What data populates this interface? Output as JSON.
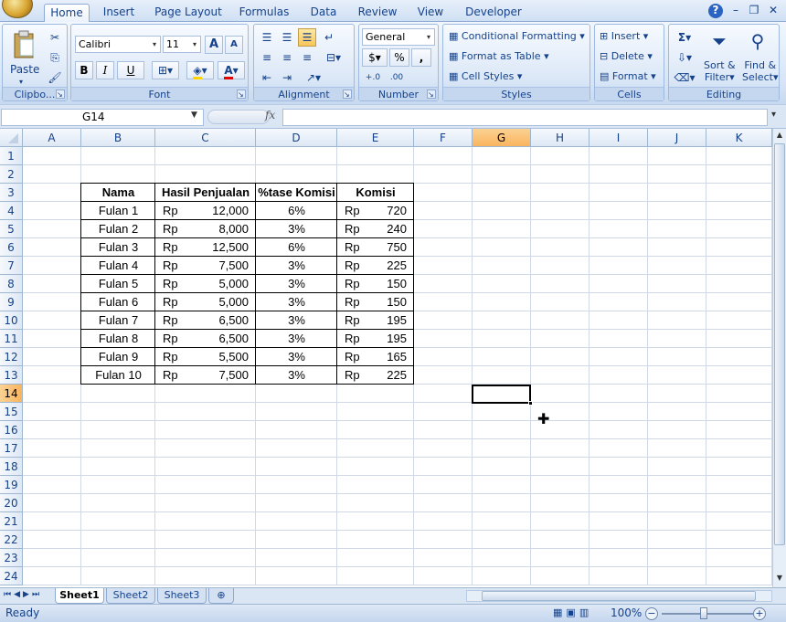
{
  "tabs": [
    "Home",
    "Insert",
    "Page Layout",
    "Formulas",
    "Data",
    "Review",
    "View",
    "Developer"
  ],
  "active_tab": "Home",
  "window": {
    "help": "?",
    "minimize": "–",
    "restore": "❐",
    "close": "✕"
  },
  "ribbon": {
    "clipboard": {
      "label": "Clipbo...",
      "paste": "Paste"
    },
    "font": {
      "label": "Font",
      "name": "Calibri",
      "size": "11",
      "grow": "A",
      "shrink": "A",
      "bold": "B",
      "italic": "I",
      "underline": "U",
      "fontcolor": "A"
    },
    "alignment": {
      "label": "Alignment"
    },
    "number": {
      "label": "Number",
      "format": "General",
      "currency": "$",
      "percent": "%",
      "comma": ","
    },
    "styles": {
      "label": "Styles",
      "conditional": "Conditional Formatting",
      "format_table": "Format as Table",
      "cell_styles": "Cell Styles"
    },
    "cells": {
      "label": "Cells",
      "insert": "Insert",
      "delete": "Delete",
      "format": "Format"
    },
    "editing": {
      "label": "Editing",
      "sort1": "Sort &",
      "sort2": "Filter",
      "find1": "Find &",
      "find2": "Select"
    }
  },
  "formula_bar": {
    "name_box": "G14",
    "fx": "fx",
    "formula": ""
  },
  "columns": [
    "A",
    "B",
    "C",
    "D",
    "E",
    "F",
    "G",
    "H",
    "I",
    "J",
    "K"
  ],
  "selected_column": "G",
  "selected_row": 14,
  "rows": [
    1,
    2,
    3,
    4,
    5,
    6,
    7,
    8,
    9,
    10,
    11,
    12,
    13,
    14,
    15,
    16,
    17,
    18,
    19,
    20,
    21,
    22,
    23,
    24
  ],
  "table": {
    "headers": [
      "Nama",
      "Hasil Penjualan",
      "%tase Komisi",
      "Komisi"
    ],
    "rows": [
      {
        "nama": "Fulan 1",
        "rp1": "Rp",
        "hasil": "12,000",
        "pct": "6%",
        "rp2": "Rp",
        "komisi": "720"
      },
      {
        "nama": "Fulan 2",
        "rp1": "Rp",
        "hasil": "8,000",
        "pct": "3%",
        "rp2": "Rp",
        "komisi": "240"
      },
      {
        "nama": "Fulan 3",
        "rp1": "Rp",
        "hasil": "12,500",
        "pct": "6%",
        "rp2": "Rp",
        "komisi": "750"
      },
      {
        "nama": "Fulan 4",
        "rp1": "Rp",
        "hasil": "7,500",
        "pct": "3%",
        "rp2": "Rp",
        "komisi": "225"
      },
      {
        "nama": "Fulan 5",
        "rp1": "Rp",
        "hasil": "5,000",
        "pct": "3%",
        "rp2": "Rp",
        "komisi": "150"
      },
      {
        "nama": "Fulan 6",
        "rp1": "Rp",
        "hasil": "5,000",
        "pct": "3%",
        "rp2": "Rp",
        "komisi": "150"
      },
      {
        "nama": "Fulan 7",
        "rp1": "Rp",
        "hasil": "6,500",
        "pct": "3%",
        "rp2": "Rp",
        "komisi": "195"
      },
      {
        "nama": "Fulan 8",
        "rp1": "Rp",
        "hasil": "6,500",
        "pct": "3%",
        "rp2": "Rp",
        "komisi": "195"
      },
      {
        "nama": "Fulan 9",
        "rp1": "Rp",
        "hasil": "5,500",
        "pct": "3%",
        "rp2": "Rp",
        "komisi": "165"
      },
      {
        "nama": "Fulan 10",
        "rp1": "Rp",
        "hasil": "7,500",
        "pct": "3%",
        "rp2": "Rp",
        "komisi": "225"
      }
    ]
  },
  "sheet_tabs": [
    "Sheet1",
    "Sheet2",
    "Sheet3"
  ],
  "active_sheet": "Sheet1",
  "status": {
    "mode": "Ready",
    "zoom": "100%"
  },
  "colors": {
    "accent": "#15428b",
    "selection_header": "#f9b45e",
    "grid": "#d0d7e5"
  }
}
